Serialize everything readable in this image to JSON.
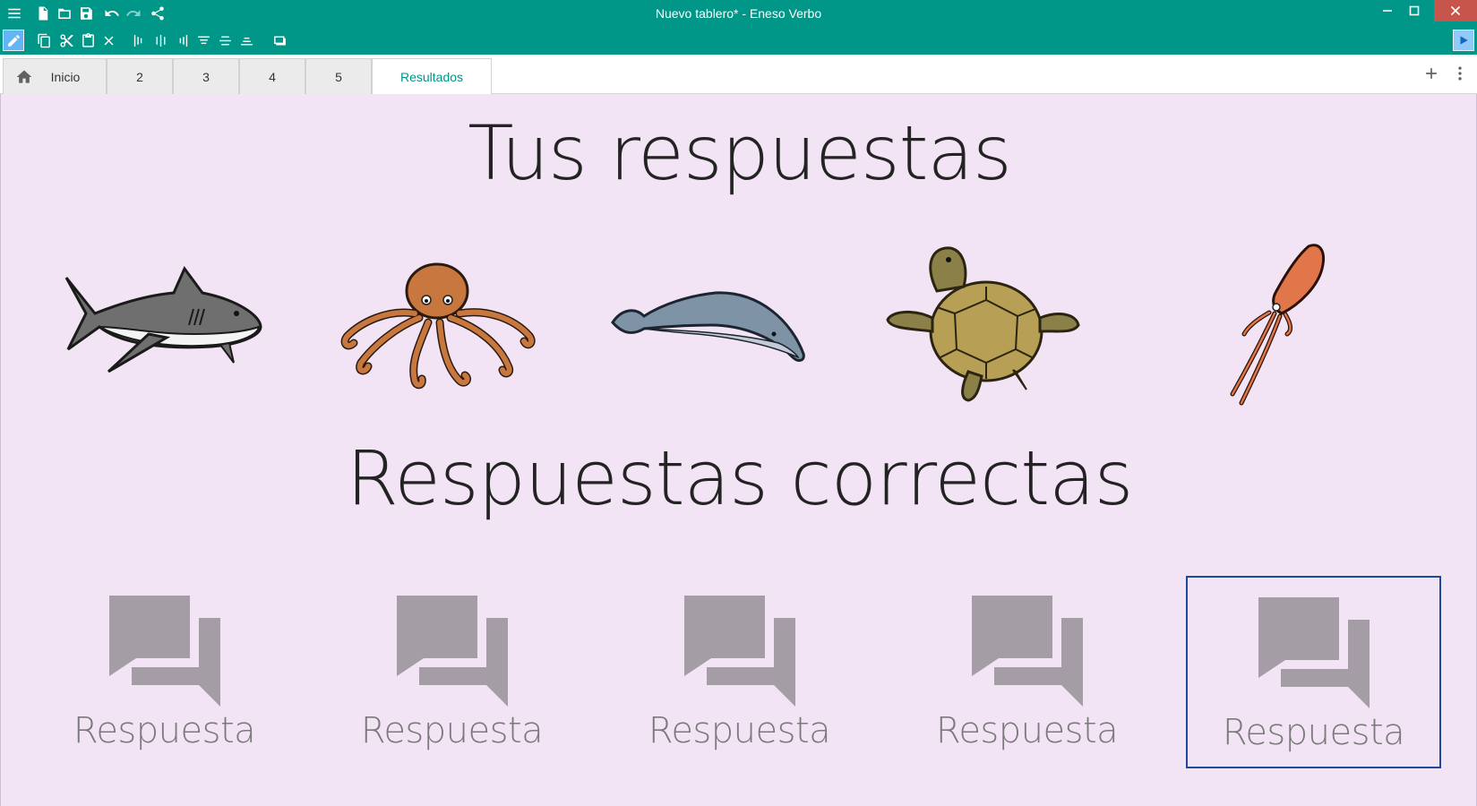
{
  "window": {
    "title": "Nuevo tablero* - Eneso Verbo",
    "accent_color": "#009688"
  },
  "tabs": [
    {
      "label": "Inicio",
      "icon": "home-icon"
    },
    {
      "label": "2"
    },
    {
      "label": "3"
    },
    {
      "label": "4"
    },
    {
      "label": "5"
    },
    {
      "label": "Resultados",
      "active": true
    }
  ],
  "board": {
    "background": "#f2e4f4",
    "heading_top": "Tus respuestas",
    "heading_bottom": "Respuestas correctas",
    "animals": [
      {
        "name": "shark-image"
      },
      {
        "name": "octopus-image"
      },
      {
        "name": "whale-image"
      },
      {
        "name": "turtle-image"
      },
      {
        "name": "squid-image"
      }
    ],
    "answers": [
      {
        "label": "Respuesta",
        "icon": "chat-bubbles-icon"
      },
      {
        "label": "Respuesta",
        "icon": "chat-bubbles-icon"
      },
      {
        "label": "Respuesta",
        "icon": "chat-bubbles-icon"
      },
      {
        "label": "Respuesta",
        "icon": "chat-bubbles-icon"
      },
      {
        "label": "Respuesta",
        "icon": "chat-bubbles-icon",
        "selected": true
      }
    ]
  }
}
